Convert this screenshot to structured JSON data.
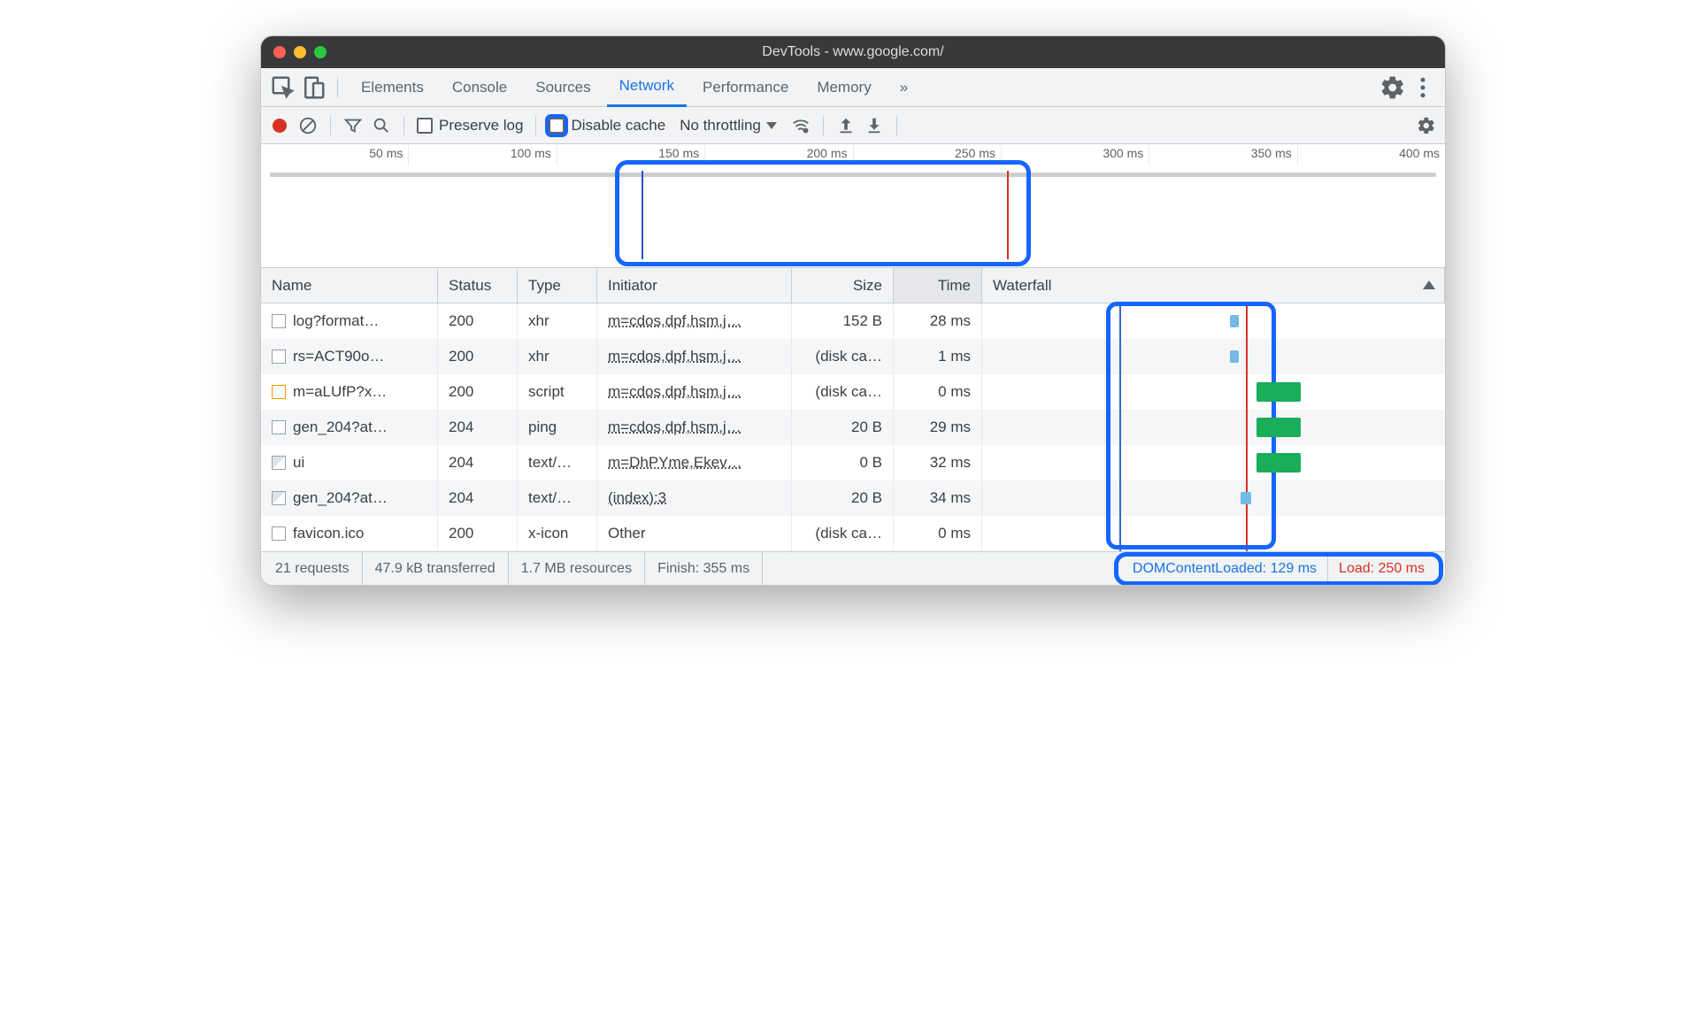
{
  "window": {
    "title": "DevTools - www.google.com/"
  },
  "tabs": {
    "elements": "Elements",
    "console": "Console",
    "sources": "Sources",
    "network": "Network",
    "performance": "Performance",
    "memory": "Memory",
    "more": "»"
  },
  "toolbar": {
    "preserve_log": "Preserve log",
    "disable_cache": "Disable cache",
    "no_throttling": "No throttling"
  },
  "timeline_ticks": [
    "50 ms",
    "100 ms",
    "150 ms",
    "200 ms",
    "250 ms",
    "300 ms",
    "350 ms",
    "400 ms"
  ],
  "columns": {
    "name": "Name",
    "status": "Status",
    "type": "Type",
    "initiator": "Initiator",
    "size": "Size",
    "time": "Time",
    "waterfall": "Waterfall"
  },
  "rows": [
    {
      "name": "log?format…",
      "status": "200",
      "type": "xhr",
      "initiator": "m=cdos,dpf,hsm,j…",
      "size": "152 B",
      "time": "28 ms",
      "ico": "plain"
    },
    {
      "name": "rs=ACT90o…",
      "status": "200",
      "type": "xhr",
      "initiator": "m=cdos,dpf,hsm,j…",
      "size": "(disk ca…",
      "time": "1 ms",
      "ico": "plain"
    },
    {
      "name": "m=aLUfP?x…",
      "status": "200",
      "type": "script",
      "initiator": "m=cdos,dpf,hsm,j…",
      "size": "(disk ca…",
      "time": "0 ms",
      "ico": "orange"
    },
    {
      "name": "gen_204?at…",
      "status": "204",
      "type": "ping",
      "initiator": "m=cdos,dpf,hsm,j…",
      "size": "20 B",
      "time": "29 ms",
      "ico": "plain"
    },
    {
      "name": "ui",
      "status": "204",
      "type": "text/…",
      "initiator": "m=DhPYme,Ekev…",
      "size": "0 B",
      "time": "32 ms",
      "ico": "img"
    },
    {
      "name": "gen_204?at…",
      "status": "204",
      "type": "text/…",
      "initiator": "(index):3",
      "size": "20 B",
      "time": "34 ms",
      "ico": "img"
    },
    {
      "name": "favicon.ico",
      "status": "200",
      "type": "x-icon",
      "initiator": "Other",
      "size": "(disk ca…",
      "time": "0 ms",
      "ico": "plain",
      "plain": true
    }
  ],
  "status": {
    "requests": "21 requests",
    "transferred": "47.9 kB transferred",
    "resources": "1.7 MB resources",
    "finish": "Finish: 355 ms",
    "dcl": "DOMContentLoaded: 129 ms",
    "load": "Load: 250 ms"
  }
}
